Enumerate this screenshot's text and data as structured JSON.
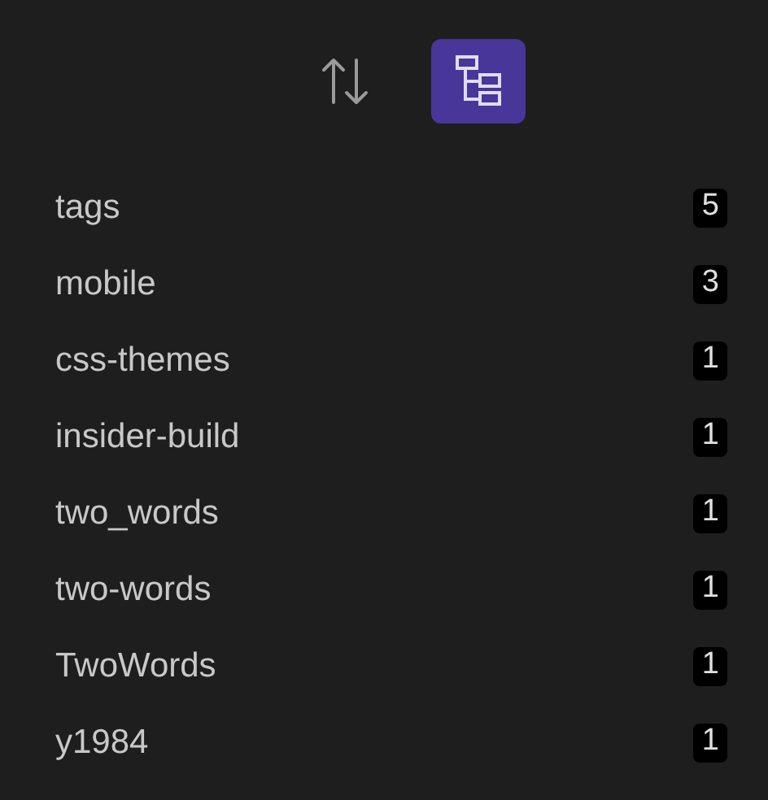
{
  "toolbar": [
    {
      "kind": "sort",
      "selected": false
    },
    {
      "kind": "tree",
      "selected": true
    }
  ],
  "tags": [
    {
      "name": "tags",
      "count": "5"
    },
    {
      "name": "mobile",
      "count": "3"
    },
    {
      "name": "css-themes",
      "count": "1"
    },
    {
      "name": "insider-build",
      "count": "1"
    },
    {
      "name": "two_words",
      "count": "1"
    },
    {
      "name": "two-words",
      "count": "1"
    },
    {
      "name": "TwoWords",
      "count": "1"
    },
    {
      "name": "y1984",
      "count": "1"
    }
  ]
}
